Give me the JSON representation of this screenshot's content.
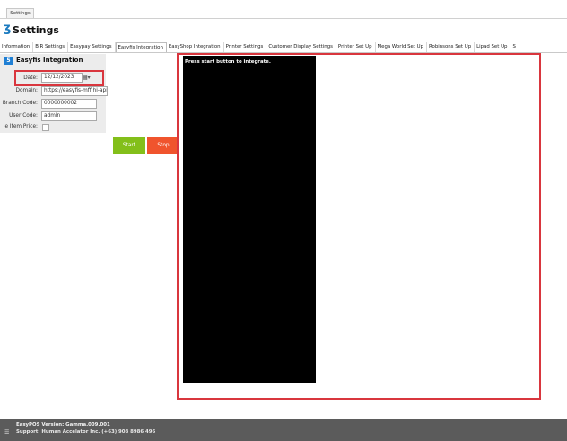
{
  "window": {
    "tab_label": "Settings"
  },
  "page": {
    "title": "Settings"
  },
  "tabs": [
    "Information",
    "BIR Settings",
    "Easypay Settings",
    "Easyfis Integration",
    "EasyShop Integration",
    "Printer Settings",
    "Customer Display Settings",
    "Printer Set Up",
    "Mega World Set Up",
    "Robinsons Set Up",
    "Lipad Set Up",
    "S"
  ],
  "active_tab": "Easyfis Integration",
  "section": {
    "logo_letter": "5",
    "title": "Easyfis Integration"
  },
  "form": {
    "date_label": "Date:",
    "date_value": "12/12/2023",
    "domain_label": "Domain:",
    "domain_value": "https://easyfis-mff.hi-api.io",
    "branch_code_label": "Branch Code:",
    "branch_code_value": "0000000002",
    "user_code_label": "User Code:",
    "user_code_value": "admin",
    "item_price_label": "e Item Price:"
  },
  "buttons": {
    "start": "Start",
    "stop": "Stop"
  },
  "console": {
    "message": "Press start button to integrate."
  },
  "footer": {
    "version": "EasyPOS Version: Gamma.009.001",
    "support": "Support: Human Accelator Inc. (+63) 908 8986 496"
  },
  "colors": {
    "start_button": "#83bf1a",
    "stop_button": "#f0542d",
    "highlight": "#d9363e",
    "footer_bg": "#5b5b5b",
    "console_bg": "#000000"
  }
}
